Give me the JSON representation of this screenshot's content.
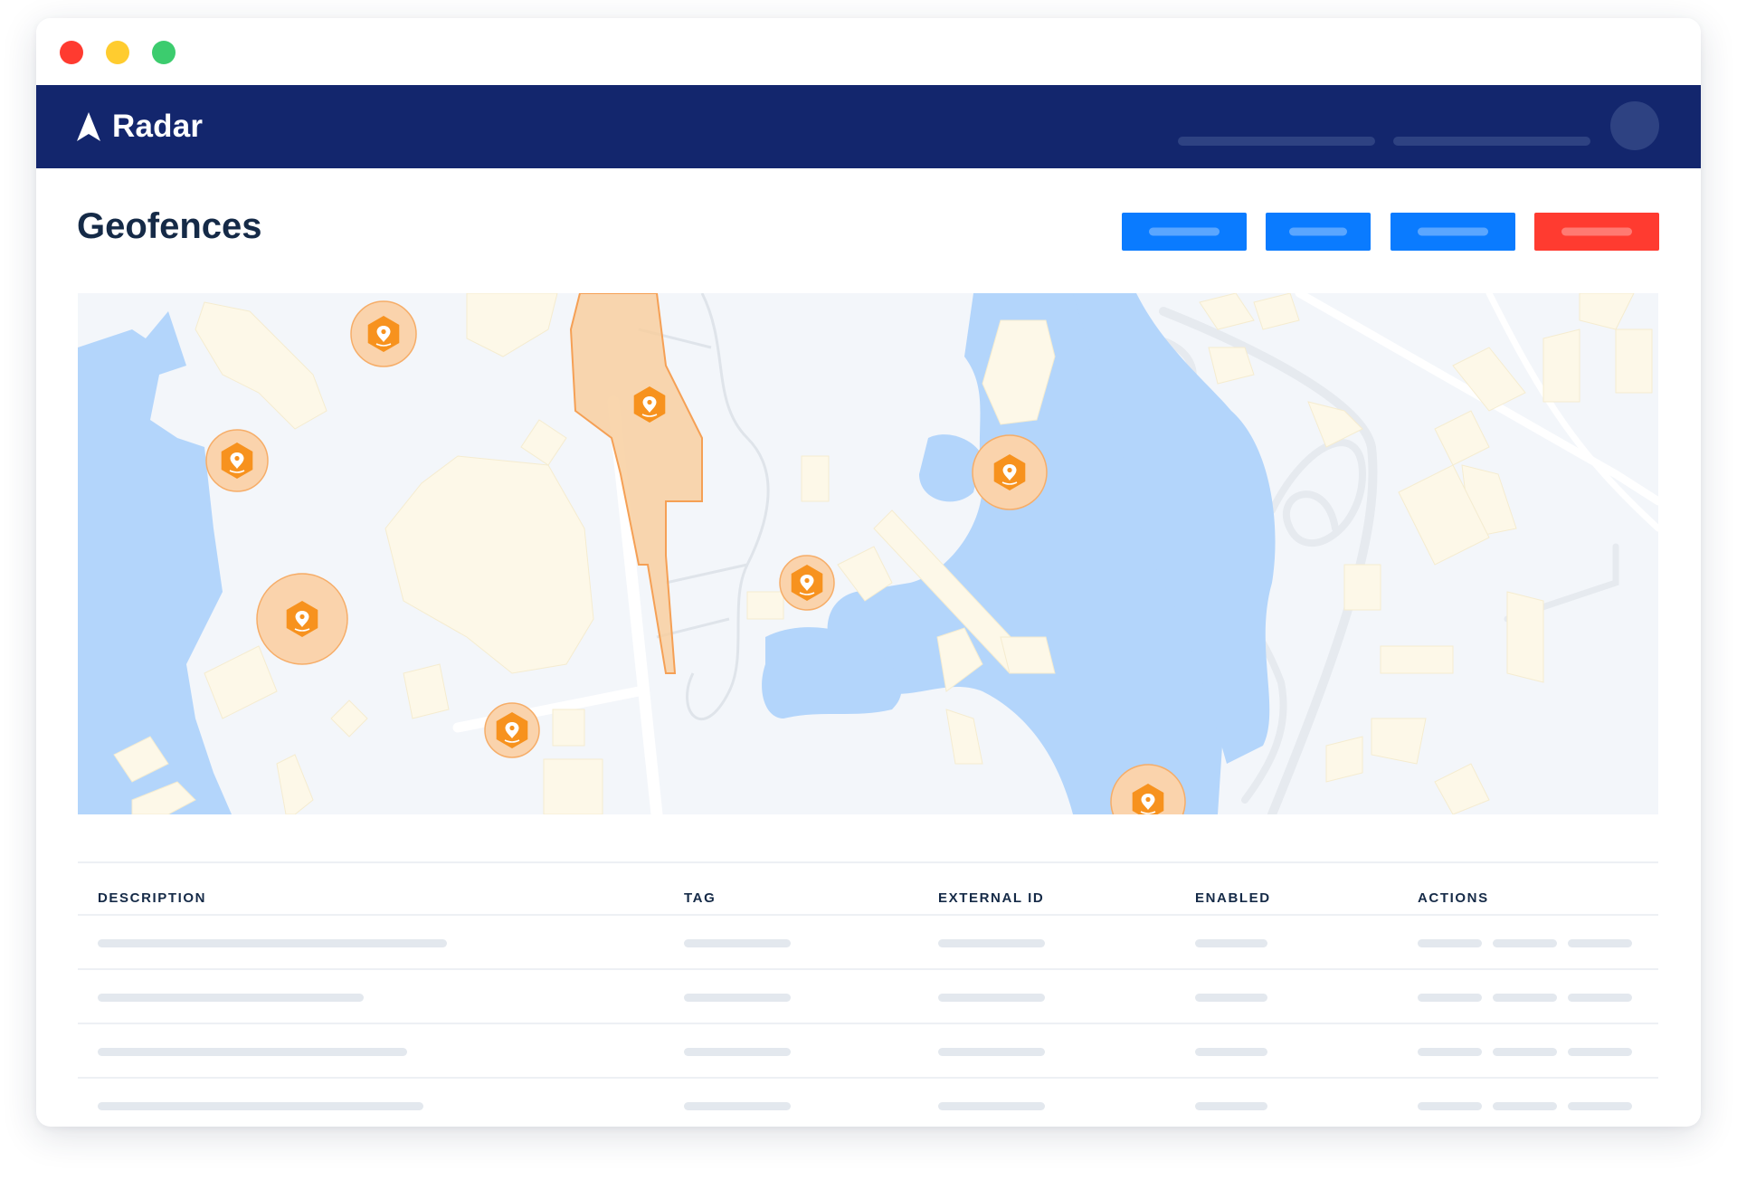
{
  "app": {
    "brand": "Radar",
    "colors": {
      "nav": "#13266d",
      "primary": "#0a7bff",
      "danger": "#ff3b30",
      "geofence": "#f7921e",
      "water": "#b3d5fb"
    }
  },
  "window_controls": [
    "close",
    "minimize",
    "maximize"
  ],
  "header": {
    "title": "Geofences"
  },
  "toolbar": {
    "buttons": [
      {
        "name": "action-1",
        "label": "",
        "style": "primary"
      },
      {
        "name": "action-2",
        "label": "",
        "style": "primary"
      },
      {
        "name": "action-3",
        "label": "",
        "style": "primary"
      },
      {
        "name": "delete",
        "label": "",
        "style": "danger"
      }
    ]
  },
  "map": {
    "marker_icon": "geofence-pin-icon",
    "marker_count": 8,
    "polygon_count": 1
  },
  "table": {
    "columns": [
      "DESCRIPTION",
      "TAG",
      "EXTERNAL ID",
      "ENABLED",
      "ACTIONS"
    ],
    "row_count": 4,
    "rows_loading": true
  }
}
